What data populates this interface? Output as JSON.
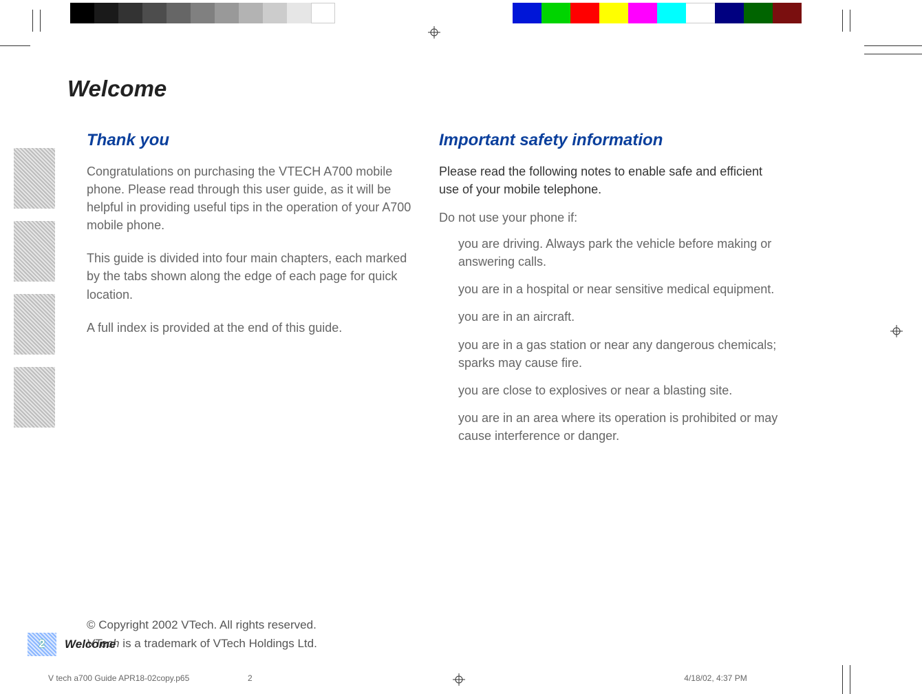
{
  "print": {
    "gray_swatches": [
      "#000000",
      "#1a1a1a",
      "#333333",
      "#4d4d4d",
      "#666666",
      "#808080",
      "#999999",
      "#b3b3b3",
      "#cccccc",
      "#e6e6e6",
      "#ffffff"
    ],
    "color_swatches": [
      "#0000ff",
      "#00ff00",
      "#ff0000",
      "#ffff00",
      "#ff00ff",
      "#00ffff",
      "#ffffff",
      "#000080",
      "#008000",
      "#800000"
    ]
  },
  "title": "Welcome",
  "left": {
    "heading": "Thank you",
    "p1": "Congratulations on purchasing the VTECH A700 mobile phone.  Please read through this user guide, as it will be helpful in providing useful tips in the operation of your A700 mobile phone.",
    "p2": "This guide is divided into four main chapters, each marked by the tabs shown along the edge of each page for quick location.",
    "p3": "A full index is provided at the end of this guide."
  },
  "right": {
    "heading": "Important safety information",
    "lead": "Please read the following notes to enable safe and efficient use of your mobile telephone.",
    "listhead": "Do not use your phone if:",
    "items": [
      "you are driving. Always park the vehicle before making or answering calls.",
      "you are in a hospital or near sensitive medical equipment.",
      "you are in an aircraft.",
      "you are in a gas station or near any dangerous chemicals; sparks may cause fire.",
      "you are close to explosives or near a blasting site.",
      "you are in an area where its operation is prohibited or may cause interference or danger."
    ]
  },
  "footer": {
    "copyright": "© Copyright 2002 VTech. All rights reserved.",
    "trademark_brand": "VTech",
    "trademark_rest": " is a trademark of VTech Holdings Ltd.",
    "page_number": "2",
    "page_label": "Welcome"
  },
  "slug": {
    "file": "V tech a700 Guide APR18-02copy.p65",
    "page": "2",
    "timestamp": "4/18/02, 4:37 PM"
  }
}
